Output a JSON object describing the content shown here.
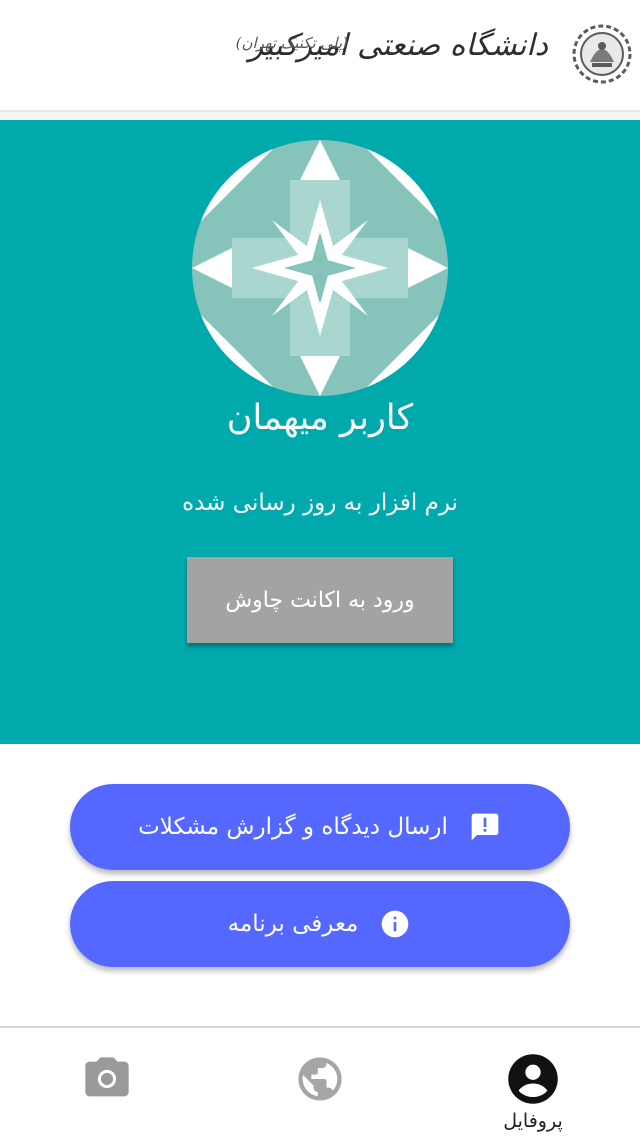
{
  "header": {
    "university_name": "دانشگاه صنعتی امیرکبیر",
    "university_subtitle": "(پلی تکنیک تهران)",
    "emblem_icon": "university-emblem-icon"
  },
  "hero": {
    "background_color": "#00a9ac",
    "avatar_icon": "geometric-pattern-avatar",
    "user_name": "کاربر میهمان",
    "update_status": "نرم افزار به روز رسانی شده",
    "login_button_label": "ورود به اکانت چاوش"
  },
  "actions": {
    "accent_color": "#5468ff",
    "feedback_label": "ارسال دیدگاه و گزارش مشکلات",
    "feedback_icon": "feedback-icon",
    "about_label": "معرفی برنامه",
    "about_icon": "info-icon"
  },
  "bottom_nav": {
    "items": [
      {
        "icon": "camera-icon",
        "label": "",
        "active": false
      },
      {
        "icon": "globe-icon",
        "label": "",
        "active": false
      },
      {
        "icon": "account-icon",
        "label": "پروفایل",
        "active": true
      }
    ]
  }
}
